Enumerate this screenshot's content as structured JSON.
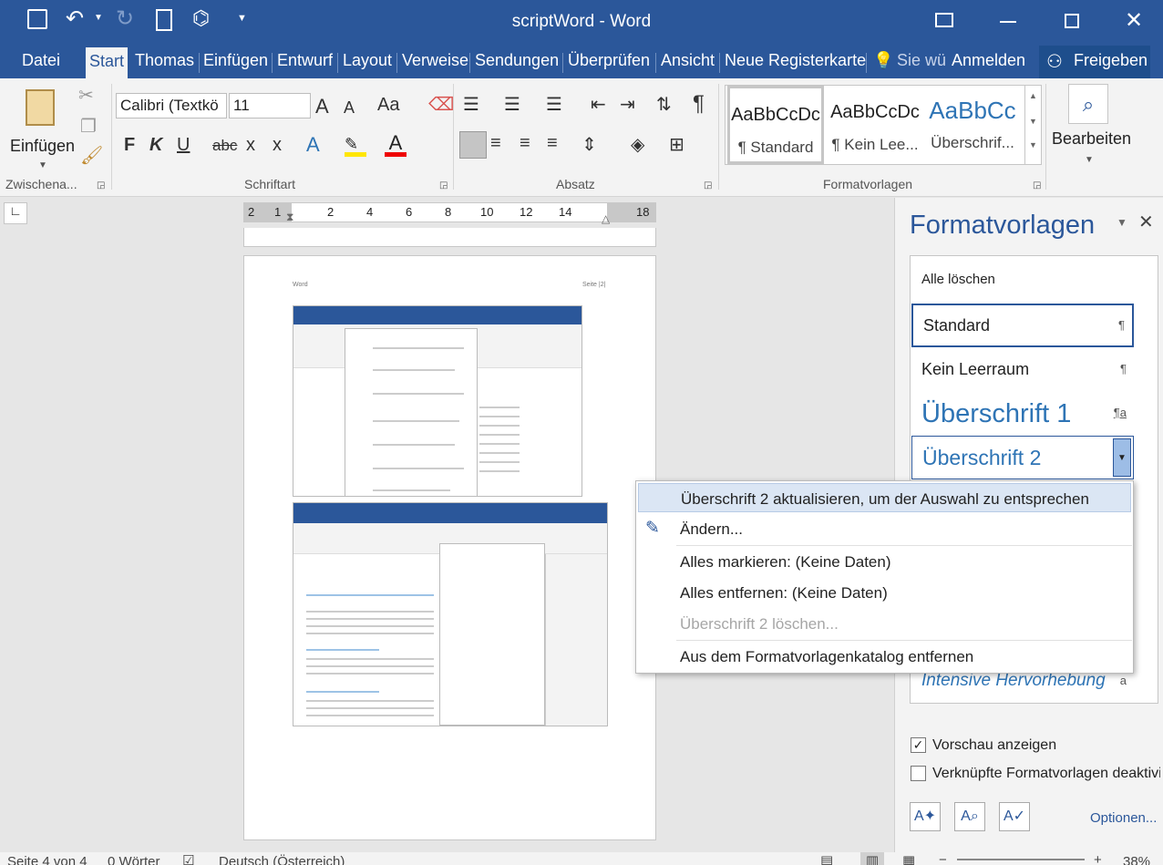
{
  "window": {
    "title": "scriptWord - Word"
  },
  "tabs": [
    "Datei",
    "Start",
    "Thomas",
    "Einfügen",
    "Entwurf",
    "Layout",
    "Verweise",
    "Sendungen",
    "Überprüfen",
    "Ansicht",
    "Neue Registerkarte"
  ],
  "tell_me": "Sie wü",
  "sign_in": "Anmelden",
  "share": "Freigeben",
  "ribbon": {
    "paste_label": "Einfügen",
    "clipboard_group": "Zwischena...",
    "font_group": "Schriftart",
    "paragraph_group": "Absatz",
    "styles_group": "Formatvorlagen",
    "edit_label": "Bearbeiten",
    "font_name": "Calibri (Textkö",
    "font_size": "11",
    "grow": "A",
    "shrink": "A",
    "case": "Aa",
    "bold": "F",
    "italic": "K",
    "underline": "U",
    "strike": "abc",
    "sub": "x",
    "sup": "x",
    "styles": [
      {
        "sample": "AaBbCcDc",
        "name": "¶ Standard"
      },
      {
        "sample": "AaBbCcDc",
        "name": "¶ Kein Lee..."
      },
      {
        "sample": "AaBbCc",
        "name": "Überschrif..."
      }
    ]
  },
  "ruler": {
    "ticks": [
      "2",
      "1",
      "2",
      "4",
      "6",
      "8",
      "10",
      "12",
      "14",
      "18"
    ]
  },
  "page": {
    "header_left": "Word",
    "header_right": "Seite |2|"
  },
  "pane": {
    "title": "Formatvorlagen",
    "clear_all": "Alle löschen",
    "items": [
      {
        "name": "Standard",
        "mark": "¶"
      },
      {
        "name": "Kein Leerraum",
        "mark": "¶"
      },
      {
        "name": "Überschrift 1",
        "mark": "¶a"
      },
      {
        "name": "Überschrift 2",
        "mark": ""
      },
      {
        "name": "Intensive Hervorhebung",
        "mark": "a"
      }
    ],
    "preview": "Vorschau anzeigen",
    "preview_checked": true,
    "linked": "Verknüpfte Formatvorlagen deaktivi",
    "options": "Optionen..."
  },
  "context_menu": [
    {
      "label": "Überschrift 2 aktualisieren, um der Auswahl zu entsprechen",
      "enabled": true
    },
    {
      "label": "Ändern...",
      "enabled": true
    },
    {
      "label": "Alles markieren: (Keine Daten)",
      "enabled": true
    },
    {
      "label": "Alles entfernen: (Keine Daten)",
      "enabled": true
    },
    {
      "label": "Überschrift 2 löschen...",
      "enabled": false
    },
    {
      "label": "Aus dem Formatvorlagenkatalog entfernen",
      "enabled": true
    }
  ],
  "status": {
    "page": "Seite 4 von 4",
    "words": "0 Wörter",
    "language": "Deutsch (Österreich)",
    "zoom": "38%"
  },
  "colors": {
    "accent": "#2b579a",
    "heading_blue": "#2e74b5"
  }
}
